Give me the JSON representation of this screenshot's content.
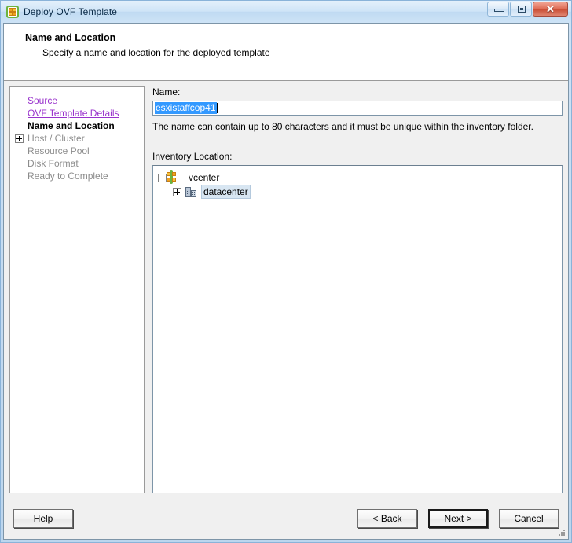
{
  "window": {
    "title": "Deploy OVF Template",
    "icon": "vsphere-logo-icon",
    "controls": {
      "minimize": "Minimize",
      "maximize": "Maximize",
      "close": "Close",
      "close_glyph": "✕"
    }
  },
  "header": {
    "title": "Name and Location",
    "subtitle": "Specify a name and location for the deployed template"
  },
  "nav": {
    "items": [
      {
        "label": "Source",
        "state": "link",
        "expander": false
      },
      {
        "label": "OVF Template Details",
        "state": "link",
        "expander": false
      },
      {
        "label": "Name and Location",
        "state": "current",
        "expander": false
      },
      {
        "label": "Host / Cluster",
        "state": "disabled",
        "expander": true
      },
      {
        "label": "Resource Pool",
        "state": "disabled",
        "expander": false
      },
      {
        "label": "Disk Format",
        "state": "disabled",
        "expander": false
      },
      {
        "label": "Ready to Complete",
        "state": "disabled",
        "expander": false
      }
    ]
  },
  "form": {
    "name_label": "Name:",
    "name_value": "esxistaffcop41",
    "name_hint": "The name can contain up to 80 characters and it must be unique within the inventory folder.",
    "inventory_label": "Inventory Location:"
  },
  "tree": {
    "root": {
      "label": "vcenter",
      "icon": "vsphere-logo-icon",
      "expanded": true,
      "selected": false
    },
    "child": {
      "label": "datacenter",
      "icon": "datacenter-building-icon",
      "expanded": false,
      "selected": true
    }
  },
  "footer": {
    "help": "Help",
    "back": "< Back",
    "next": "Next >",
    "cancel": "Cancel"
  },
  "colors": {
    "link": "#9933cc",
    "selection": "#3399ff",
    "tree_selection": "#d8e6f2",
    "titlebar": "#cfe4f7",
    "accent_green": "#6cb33f",
    "accent_orange": "#f0a11e"
  }
}
